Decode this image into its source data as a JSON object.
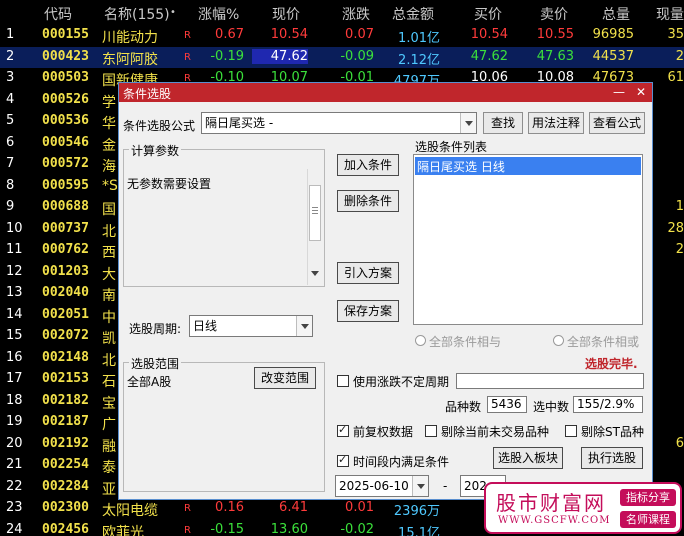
{
  "table": {
    "headers": [
      "代码",
      "名称(155)",
      "•",
      "涨幅%",
      "现价",
      "涨跌",
      "总金额",
      "买价",
      "卖价",
      "总量",
      "现量"
    ],
    "rows": [
      {
        "idx": "1",
        "code": "000155",
        "name": "川能动力",
        "flag": "R",
        "pct": "0.67",
        "price": "10.54",
        "chg": "0.07",
        "amt": "1.01亿",
        "buy": "10.54",
        "sell": "10.55",
        "vol": "96985",
        "cur": "35",
        "dir": "up"
      },
      {
        "idx": "2",
        "code": "000423",
        "name": "东阿阿胶",
        "flag": "R",
        "pct": "-0.19",
        "price": "47.62",
        "chg": "-0.09",
        "amt": "2.12亿",
        "buy": "47.62",
        "sell": "47.63",
        "vol": "44537",
        "cur": "2",
        "dir": "dn"
      },
      {
        "idx": "3",
        "code": "000503",
        "name": "国新健康",
        "flag": "R",
        "pct": "-0.10",
        "price": "10.07",
        "chg": "-0.01",
        "amt": "4797万",
        "buy": "10.06",
        "sell": "10.08",
        "vol": "47673",
        "cur": "61",
        "dir": "dn"
      },
      {
        "idx": "4",
        "code": "000526",
        "name": "学",
        "flag": "",
        "pct": "",
        "price": "",
        "chg": "",
        "amt": "",
        "buy": "",
        "sell": "",
        "vol": "",
        "cur": "",
        "dir": "up"
      },
      {
        "idx": "5",
        "code": "000536",
        "name": "华",
        "flag": "",
        "pct": "",
        "price": "",
        "chg": "",
        "amt": "",
        "buy": "",
        "sell": "",
        "vol": "",
        "cur": "",
        "dir": "up"
      },
      {
        "idx": "6",
        "code": "000546",
        "name": "金",
        "flag": "",
        "pct": "",
        "price": "",
        "chg": "",
        "amt": "",
        "buy": "",
        "sell": "",
        "vol": "",
        "cur": "",
        "dir": "up"
      },
      {
        "idx": "7",
        "code": "000572",
        "name": "海",
        "flag": "",
        "pct": "",
        "price": "",
        "chg": "",
        "amt": "",
        "buy": "",
        "sell": "",
        "vol": "",
        "cur": "",
        "dir": "up"
      },
      {
        "idx": "8",
        "code": "000595",
        "name": "*S",
        "flag": "",
        "pct": "",
        "price": "",
        "chg": "",
        "amt": "",
        "buy": "",
        "sell": "",
        "vol": "",
        "cur": "",
        "dir": "up"
      },
      {
        "idx": "9",
        "code": "000688",
        "name": "国",
        "flag": "",
        "pct": "",
        "price": "",
        "chg": "",
        "amt": "",
        "buy": "",
        "sell": "",
        "vol": "",
        "cur": "1",
        "dir": "up"
      },
      {
        "idx": "10",
        "code": "000737",
        "name": "北",
        "flag": "",
        "pct": "",
        "price": "",
        "chg": "",
        "amt": "",
        "buy": "",
        "sell": "",
        "vol": "",
        "cur": "28",
        "dir": "up"
      },
      {
        "idx": "11",
        "code": "000762",
        "name": "西",
        "flag": "",
        "pct": "",
        "price": "",
        "chg": "",
        "amt": "",
        "buy": "",
        "sell": "",
        "vol": "",
        "cur": "2",
        "dir": "up"
      },
      {
        "idx": "12",
        "code": "001203",
        "name": "大",
        "flag": "",
        "pct": "",
        "price": "",
        "chg": "",
        "amt": "",
        "buy": "",
        "sell": "",
        "vol": "",
        "cur": "",
        "dir": "up"
      },
      {
        "idx": "13",
        "code": "002040",
        "name": "南",
        "flag": "",
        "pct": "",
        "price": "",
        "chg": "",
        "amt": "",
        "buy": "",
        "sell": "",
        "vol": "",
        "cur": "",
        "dir": "up"
      },
      {
        "idx": "14",
        "code": "002051",
        "name": "中",
        "flag": "",
        "pct": "",
        "price": "",
        "chg": "",
        "amt": "",
        "buy": "",
        "sell": "",
        "vol": "",
        "cur": "",
        "dir": "up"
      },
      {
        "idx": "15",
        "code": "002072",
        "name": "凯",
        "flag": "",
        "pct": "",
        "price": "",
        "chg": "",
        "amt": "",
        "buy": "",
        "sell": "",
        "vol": "",
        "cur": "",
        "dir": "up"
      },
      {
        "idx": "16",
        "code": "002148",
        "name": "北",
        "flag": "",
        "pct": "",
        "price": "",
        "chg": "",
        "amt": "",
        "buy": "",
        "sell": "",
        "vol": "",
        "cur": "",
        "dir": "up"
      },
      {
        "idx": "17",
        "code": "002153",
        "name": "石",
        "flag": "",
        "pct": "",
        "price": "",
        "chg": "",
        "amt": "",
        "buy": "",
        "sell": "",
        "vol": "",
        "cur": "",
        "dir": "up"
      },
      {
        "idx": "18",
        "code": "002182",
        "name": "宝",
        "flag": "",
        "pct": "",
        "price": "",
        "chg": "",
        "amt": "",
        "buy": "",
        "sell": "",
        "vol": "",
        "cur": "",
        "dir": "up"
      },
      {
        "idx": "19",
        "code": "002187",
        "name": "广",
        "flag": "",
        "pct": "",
        "price": "",
        "chg": "",
        "amt": "",
        "buy": "",
        "sell": "",
        "vol": "",
        "cur": "",
        "dir": "up"
      },
      {
        "idx": "20",
        "code": "002192",
        "name": "融",
        "flag": "",
        "pct": "",
        "price": "",
        "chg": "",
        "amt": "",
        "buy": "",
        "sell": "",
        "vol": "",
        "cur": "6",
        "dir": "up"
      },
      {
        "idx": "21",
        "code": "002254",
        "name": "泰",
        "flag": "",
        "pct": "",
        "price": "",
        "chg": "",
        "amt": "",
        "buy": "",
        "sell": "",
        "vol": "",
        "cur": "",
        "dir": "up"
      },
      {
        "idx": "22",
        "code": "002284",
        "name": "亚",
        "flag": "",
        "pct": "",
        "price": "",
        "chg": "",
        "amt": "",
        "buy": "",
        "sell": "",
        "vol": "",
        "cur": "",
        "dir": "up"
      },
      {
        "idx": "23",
        "code": "002300",
        "name": "太阳电缆",
        "flag": "R",
        "pct": "0.16",
        "price": "6.41",
        "chg": "0.01",
        "amt": "2396万",
        "buy": "",
        "sell": "",
        "vol": "",
        "cur": "",
        "dir": "up"
      },
      {
        "idx": "24",
        "code": "002456",
        "name": "欧菲光",
        "flag": "R",
        "pct": "-0.15",
        "price": "13.60",
        "chg": "-0.02",
        "amt": "15.1亿",
        "buy": "",
        "sell": "",
        "vol": "",
        "cur": "",
        "dir": "dn"
      }
    ]
  },
  "dialog": {
    "title": "条件选股",
    "min_glyph": "—",
    "close_glyph": "✕",
    "formula_label": "条件选股公式",
    "formula_value": "隔日尾买选  -",
    "btn_find": "查找",
    "btn_usage": "用法注释",
    "btn_view": "查看公式",
    "params_group": "计算参数",
    "params_text": "无参数需要设置",
    "btn_add": "加入条件",
    "btn_delete": "删除条件",
    "conditions_group": "选股条件列表",
    "conditions": [
      "隔日尾买选  日线"
    ],
    "btn_import": "引入方案",
    "btn_save": "保存方案",
    "period_label": "选股周期:",
    "period_value": "日线",
    "radio_and": "全部条件相与",
    "radio_or": "全部条件相或",
    "status_text": "选股完毕.",
    "range_group": "选股范围",
    "range_value": "全部A股",
    "btn_change_range": "改变范围",
    "use_unclosed_label": "使用涨跌不定周期",
    "count_label": "品种数",
    "count_value": "5436",
    "selected_label": "选中数",
    "selected_value": "155/2.9%",
    "fq_label": "前复权数据",
    "exclude_untraded_label": "剔除当前未交易品种",
    "exclude_st_label": "剔除ST品种",
    "time_range_label": "时间段内满足条件",
    "btn_to_block": "选股入板块",
    "btn_run": "执行选股",
    "date_from": "2025-06-10",
    "date_sep": "-",
    "date_to": "202"
  },
  "watermark": {
    "main": "股市财富网",
    "url": "WWW.GSCFW.COM",
    "tag1": "指标分享",
    "tag2": "名师课程"
  },
  "colors": {
    "title_bar": "#c0262c",
    "up": "#ff3b3b",
    "down": "#3be03b",
    "code": "#f2e14b",
    "amount": "#4fc9ff",
    "status": "#c0262c"
  }
}
